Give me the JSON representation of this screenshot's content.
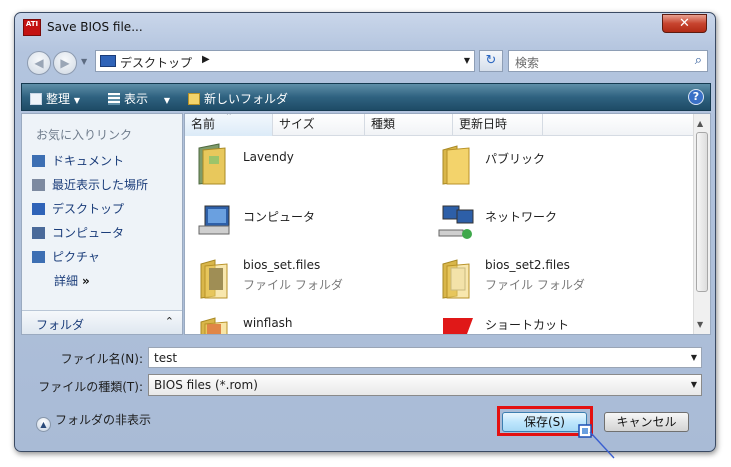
{
  "window": {
    "title": "Save BIOS file...",
    "app_icon_text": "ATI",
    "close_label": "✕"
  },
  "address": {
    "location": "デスクトップ",
    "refresh_label": "↻"
  },
  "search": {
    "placeholder": "検索"
  },
  "toolbar": {
    "organize": "整理",
    "views": "表示",
    "new_folder": "新しいフォルダ",
    "help": "?"
  },
  "sidebar": {
    "header": "お気に入りリンク",
    "items": [
      {
        "label": "ドキュメント",
        "icon": "documents-icon",
        "color": "#3d6fb3"
      },
      {
        "label": "最近表示した場所",
        "icon": "recent-places-icon",
        "color": "#7d8aa0"
      },
      {
        "label": "デスクトップ",
        "icon": "desktop-icon",
        "color": "#2f63b8"
      },
      {
        "label": "コンピュータ",
        "icon": "computer-icon",
        "color": "#4a6a9a"
      },
      {
        "label": "ピクチャ",
        "icon": "pictures-icon",
        "color": "#3d6fb3"
      }
    ],
    "details": "詳細",
    "folders": "フォルダ"
  },
  "columns": [
    "名前",
    "サイズ",
    "種類",
    "更新日時"
  ],
  "files": [
    {
      "name": "Lavendy",
      "type": "",
      "icon": "user-folder-icon"
    },
    {
      "name": "パブリック",
      "type": "",
      "icon": "folder-icon"
    },
    {
      "name": "コンピュータ",
      "type": "",
      "icon": "computer-icon"
    },
    {
      "name": "ネットワーク",
      "type": "",
      "icon": "network-icon"
    },
    {
      "name": "bios_set.files",
      "type": "ファイル フォルダ",
      "icon": "folder-icon"
    },
    {
      "name": "bios_set2.files",
      "type": "ファイル フォルダ",
      "icon": "folder-icon"
    },
    {
      "name": "winflash",
      "type": "",
      "icon": "folder-icon"
    },
    {
      "name": "ショートカット",
      "type": "",
      "icon": "shortcut-icon"
    }
  ],
  "form": {
    "filename_label": "ファイル名(N):",
    "filename_value": "test",
    "filetype_label": "ファイルの種類(T):",
    "filetype_value": "BIOS files (*.rom)",
    "hide_folders": "フォルダの非表示",
    "save": "保存(S)",
    "cancel": "キャンセル"
  },
  "colors": {
    "toolbar": "#2f6280",
    "highlight": "#e41010",
    "link": "#1b3d7a"
  }
}
